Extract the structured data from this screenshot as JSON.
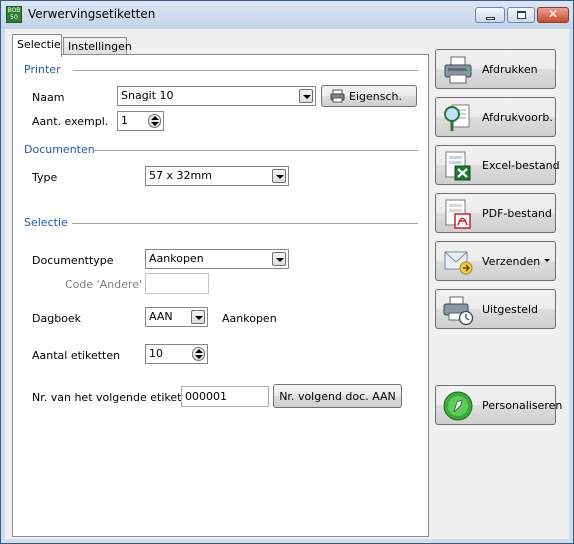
{
  "window": {
    "title": "Verwervingsetiketten",
    "app_icon_text": "BOB 50"
  },
  "tabs": [
    {
      "label": "Selectie",
      "active": true
    },
    {
      "label": "Instellingen",
      "active": false
    }
  ],
  "printer": {
    "section": "Printer",
    "naam_label": "Naam",
    "naam_value": "Snagit 10",
    "eigensch_button": "Eigensch.",
    "copies_label": "Aant. exempl.",
    "copies_value": "1"
  },
  "documenten": {
    "section": "Documenten",
    "type_label": "Type",
    "type_value": "57 x 32mm"
  },
  "selectie": {
    "section": "Selectie",
    "doctype_label": "Documenttype",
    "doctype_value": "Aankopen",
    "code_andere_label": "Code 'Andere'",
    "code_andere_value": "",
    "dagboek_label": "Dagboek",
    "dagboek_value": "AAN",
    "dagboek_desc": "Aankopen",
    "aantal_label": "Aantal etiketten",
    "aantal_value": "10",
    "next_label": "Nr. van het volgende etiket",
    "next_value": "000001",
    "next_button": "Nr. volgend doc. AAN"
  },
  "actions": {
    "print": "Afdrukken",
    "preview": "Afdrukvoorb.",
    "excel": "Excel-bestand",
    "pdf": "PDF-bestand",
    "send": "Verzenden",
    "delayed": "Uitgesteld",
    "personalize": "Personaliseren"
  },
  "colors": {
    "section_blue": "#1e5aa8",
    "excel_green": "#1e7a32",
    "pdf_red": "#c8202a"
  }
}
